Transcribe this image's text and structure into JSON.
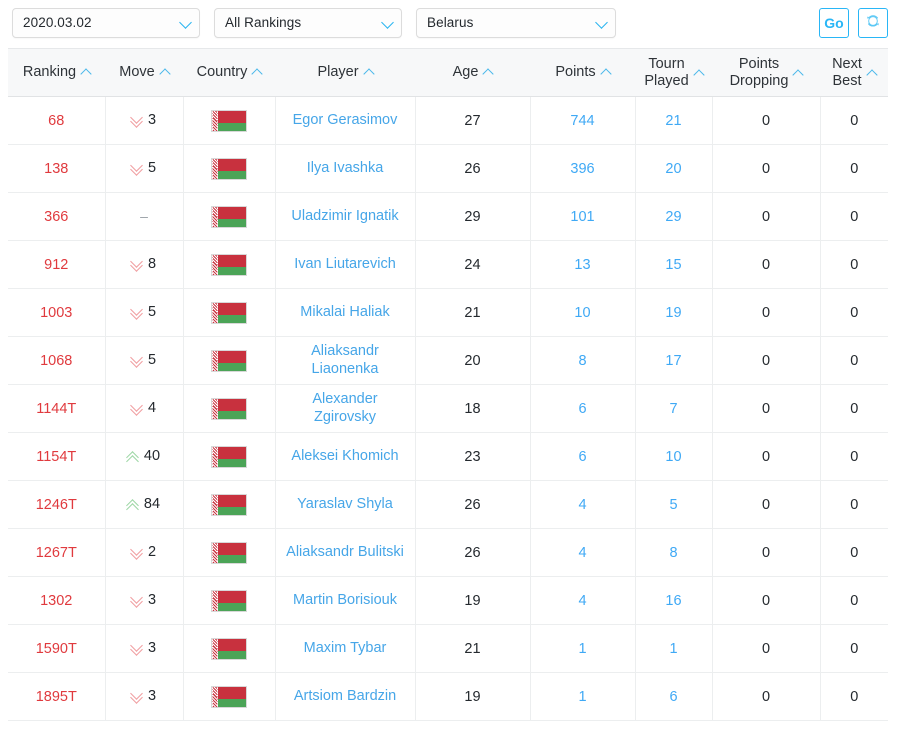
{
  "toolbar": {
    "date_value": "2020.03.02",
    "rankings_value": "All Rankings",
    "country_value": "Belarus",
    "go_label": "Go",
    "reset_icon": "refresh-circle-icon",
    "caret_icon": "chevron-down-icon",
    "accent_color": "#29b6f6"
  },
  "table": {
    "columns": [
      {
        "key": "ranking",
        "label": "Ranking",
        "sort_icon": "chevron-up-icon"
      },
      {
        "key": "move",
        "label": "Move",
        "sort_icon": "chevron-up-icon"
      },
      {
        "key": "country",
        "label": "Country",
        "sort_icon": "chevron-up-icon"
      },
      {
        "key": "player",
        "label": "Player",
        "sort_icon": "chevron-up-icon"
      },
      {
        "key": "age",
        "label": "Age",
        "sort_icon": "chevron-up-icon"
      },
      {
        "key": "points",
        "label": "Points",
        "sort_icon": "chevron-up-icon"
      },
      {
        "key": "tourn_played",
        "label": "Tourn\nPlayed",
        "label_line1": "Tourn",
        "label_line2": "Played",
        "sort_icon": "chevron-up-icon"
      },
      {
        "key": "points_dropping",
        "label": "Points\nDropping",
        "label_line1": "Points",
        "label_line2": "Dropping",
        "sort_icon": "chevron-up-icon"
      },
      {
        "key": "next_best",
        "label": "Next\nBest",
        "label_line1": "Next",
        "label_line2": "Best",
        "sort_icon": "chevron-up-icon"
      }
    ],
    "rows": [
      {
        "ranking": "68",
        "move_dir": "down",
        "move": "3",
        "country": "Belarus",
        "player": "Egor Gerasimov",
        "age": "27",
        "points": "744",
        "tourn_played": "21",
        "points_dropping": "0",
        "next_best": "0"
      },
      {
        "ranking": "138",
        "move_dir": "down",
        "move": "5",
        "country": "Belarus",
        "player": "Ilya Ivashka",
        "age": "26",
        "points": "396",
        "tourn_played": "20",
        "points_dropping": "0",
        "next_best": "0"
      },
      {
        "ranking": "366",
        "move_dir": "none",
        "move": "–",
        "country": "Belarus",
        "player": "Uladzimir Ignatik",
        "age": "29",
        "points": "101",
        "tourn_played": "29",
        "points_dropping": "0",
        "next_best": "0"
      },
      {
        "ranking": "912",
        "move_dir": "down",
        "move": "8",
        "country": "Belarus",
        "player": "Ivan Liutarevich",
        "age": "24",
        "points": "13",
        "tourn_played": "15",
        "points_dropping": "0",
        "next_best": "0"
      },
      {
        "ranking": "1003",
        "move_dir": "down",
        "move": "5",
        "country": "Belarus",
        "player": "Mikalai Haliak",
        "age": "21",
        "points": "10",
        "tourn_played": "19",
        "points_dropping": "0",
        "next_best": "0"
      },
      {
        "ranking": "1068",
        "move_dir": "down",
        "move": "5",
        "country": "Belarus",
        "player": "Aliaksandr Liaonenka",
        "age": "20",
        "points": "8",
        "tourn_played": "17",
        "points_dropping": "0",
        "next_best": "0"
      },
      {
        "ranking": "1144T",
        "move_dir": "down",
        "move": "4",
        "country": "Belarus",
        "player": "Alexander Zgirovsky",
        "age": "18",
        "points": "6",
        "tourn_played": "7",
        "points_dropping": "0",
        "next_best": "0"
      },
      {
        "ranking": "1154T",
        "move_dir": "up",
        "move": "40",
        "country": "Belarus",
        "player": "Aleksei Khomich",
        "age": "23",
        "points": "6",
        "tourn_played": "10",
        "points_dropping": "0",
        "next_best": "0"
      },
      {
        "ranking": "1246T",
        "move_dir": "up",
        "move": "84",
        "country": "Belarus",
        "player": "Yaraslav Shyla",
        "age": "26",
        "points": "4",
        "tourn_played": "5",
        "points_dropping": "0",
        "next_best": "0"
      },
      {
        "ranking": "1267T",
        "move_dir": "down",
        "move": "2",
        "country": "Belarus",
        "player": "Aliaksandr Bulitski",
        "age": "26",
        "points": "4",
        "tourn_played": "8",
        "points_dropping": "0",
        "next_best": "0"
      },
      {
        "ranking": "1302",
        "move_dir": "down",
        "move": "3",
        "country": "Belarus",
        "player": "Martin Borisiouk",
        "age": "19",
        "points": "4",
        "tourn_played": "16",
        "points_dropping": "0",
        "next_best": "0"
      },
      {
        "ranking": "1590T",
        "move_dir": "down",
        "move": "3",
        "country": "Belarus",
        "player": "Maxim Tybar",
        "age": "21",
        "points": "1",
        "tourn_played": "1",
        "points_dropping": "0",
        "next_best": "0"
      },
      {
        "ranking": "1895T",
        "move_dir": "down",
        "move": "3",
        "country": "Belarus",
        "player": "Artsiom Bardzin",
        "age": "19",
        "points": "1",
        "tourn_played": "6",
        "points_dropping": "0",
        "next_best": "0"
      }
    ]
  },
  "colors": {
    "ranking_red": "#e03a3e",
    "link_blue": "#46a6e8",
    "move_down": "#f09da0",
    "move_up": "#9cd6a4",
    "header_bg": "#f7f8f9"
  }
}
